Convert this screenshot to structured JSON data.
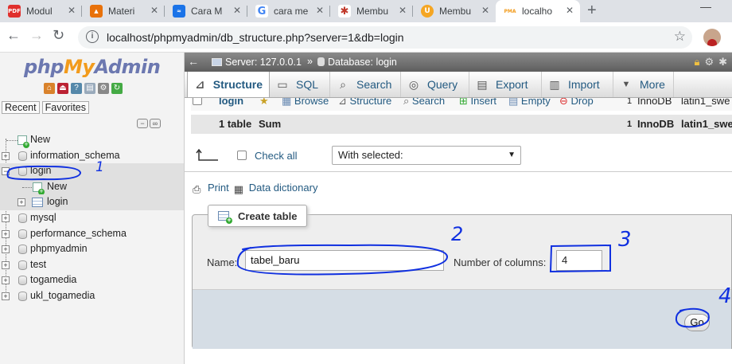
{
  "browser": {
    "tabs": [
      {
        "label": "Modul",
        "favicon": "pdf-icon",
        "favicon_text": "PDF",
        "color": "#e0302d"
      },
      {
        "label": "Materi",
        "favicon": "bookmark-icon",
        "favicon_text": "▲",
        "color": "#e8710a"
      },
      {
        "label": "Cara M",
        "favicon": "wave-icon",
        "favicon_text": "≈",
        "color": "#1a73e8"
      },
      {
        "label": "cara me",
        "favicon": "google-icon",
        "favicon_text": "G",
        "color": "#4285f4"
      },
      {
        "label": "Membu",
        "favicon": "star-logo-icon",
        "favicon_text": "✱",
        "color": "#c0392b"
      },
      {
        "label": "Membu",
        "favicon": "coin-icon",
        "favicon_text": "U",
        "color": "#f5a623"
      },
      {
        "label": "localho",
        "favicon": "pma-sail-icon",
        "favicon_text": "PMA",
        "color": "#f29b1c"
      }
    ],
    "url": "localhost/phpmyadmin/db_structure.php?server=1&db=login"
  },
  "sidebar": {
    "logo": {
      "php": "php",
      "my": "My",
      "admin": "Admin"
    },
    "tabs": [
      "Recent",
      "Favorites"
    ],
    "tree": [
      {
        "label": "New",
        "type": "new"
      },
      {
        "label": "information_schema",
        "type": "db"
      },
      {
        "label": "login",
        "type": "db",
        "expanded": true
      },
      {
        "label": "New",
        "type": "new-child"
      },
      {
        "label": "login",
        "type": "table-child"
      },
      {
        "label": "mysql",
        "type": "db"
      },
      {
        "label": "performance_schema",
        "type": "db"
      },
      {
        "label": "phpmyadmin",
        "type": "db"
      },
      {
        "label": "test",
        "type": "db"
      },
      {
        "label": "togamedia",
        "type": "db"
      },
      {
        "label": "ukl_togamedia",
        "type": "db"
      }
    ]
  },
  "breadcrumb": {
    "server": "Server: 127.0.0.1",
    "separator": "»",
    "database": "Database: login"
  },
  "menu": {
    "structure": "Structure",
    "sql": "SQL",
    "search": "Search",
    "query": "Query",
    "export": "Export",
    "import": "Import",
    "more": "More"
  },
  "table_list": {
    "login_row": {
      "name": "login",
      "browse": "Browse",
      "structure": "Structure",
      "search": "Search",
      "insert": "Insert",
      "empty": "Empty",
      "drop": "Drop",
      "rows": "1",
      "engine": "InnoDB",
      "collation": "latin1_swe"
    },
    "sum_row": {
      "tables": "1 table",
      "sum": "Sum",
      "rows": "1",
      "engine": "InnoDB",
      "collation": "latin1_swe"
    },
    "check_all": "Check all",
    "with_selected": "With selected:"
  },
  "links": {
    "print": "Print",
    "data_dictionary": "Data dictionary"
  },
  "create_table": {
    "legend": "Create table",
    "name_label": "Name:",
    "name_value": "tabel_baru",
    "columns_label": "Number of columns:",
    "columns_value": "4",
    "go": "Go"
  },
  "annotations": [
    "1",
    "2",
    "3",
    "4"
  ],
  "colors": {
    "link": "#235a81",
    "annotation_ink": "#1030e0",
    "footer_bg": "#d5dde5"
  }
}
